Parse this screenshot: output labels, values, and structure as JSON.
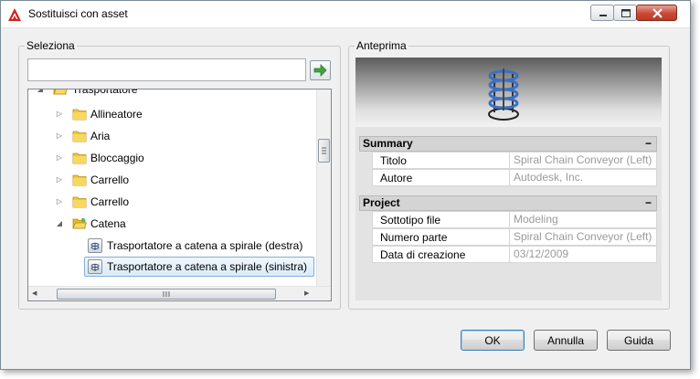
{
  "window": {
    "title": "Sostituisci con asset"
  },
  "left_group": {
    "label": "Seleziona",
    "search": {
      "value": "",
      "placeholder": ""
    }
  },
  "tree": {
    "items": [
      {
        "label": "Trasportatore",
        "level": 0,
        "expanded": true,
        "icon": "folder-open-icon"
      },
      {
        "label": "Allineatore",
        "level": 1,
        "expanded": false,
        "icon": "folder-icon"
      },
      {
        "label": "Aria",
        "level": 1,
        "expanded": false,
        "icon": "folder-icon"
      },
      {
        "label": "Bloccaggio",
        "level": 1,
        "expanded": false,
        "icon": "folder-icon"
      },
      {
        "label": "Carrello",
        "level": 1,
        "expanded": false,
        "icon": "folder-icon"
      },
      {
        "label": "Carrello",
        "level": 1,
        "expanded": false,
        "icon": "folder-icon"
      },
      {
        "label": "Catena",
        "level": 1,
        "expanded": true,
        "icon": "folder-open-icon"
      },
      {
        "label": "Trasportatore a catena a spirale (destra)",
        "level": 2,
        "icon": "asset-icon"
      },
      {
        "label": "Trasportatore a catena a spirale (sinistra)",
        "level": 2,
        "icon": "asset-icon",
        "selected": true
      }
    ]
  },
  "right_group": {
    "label": "Anteprima",
    "sections": [
      {
        "title": "Summary",
        "toggle": "−",
        "rows": [
          {
            "name": "Titolo",
            "value": "Spiral Chain Conveyor (Left)"
          },
          {
            "name": "Autore",
            "value": "Autodesk, Inc."
          }
        ]
      },
      {
        "title": "Project",
        "toggle": "−",
        "rows": [
          {
            "name": "Sottotipo file",
            "value": "Modeling"
          },
          {
            "name": "Numero parte",
            "value": "Spiral Chain Conveyor (Left)"
          },
          {
            "name": "Data di creazione",
            "value": "03/12/2009"
          }
        ]
      }
    ]
  },
  "buttons": {
    "ok": "OK",
    "cancel": "Annulla",
    "help": "Guida"
  },
  "colors": {
    "folder": "#f2c935",
    "close_button": "#c74a36",
    "go_arrow": "#3ea53e",
    "selection": "#d9ebfa"
  }
}
